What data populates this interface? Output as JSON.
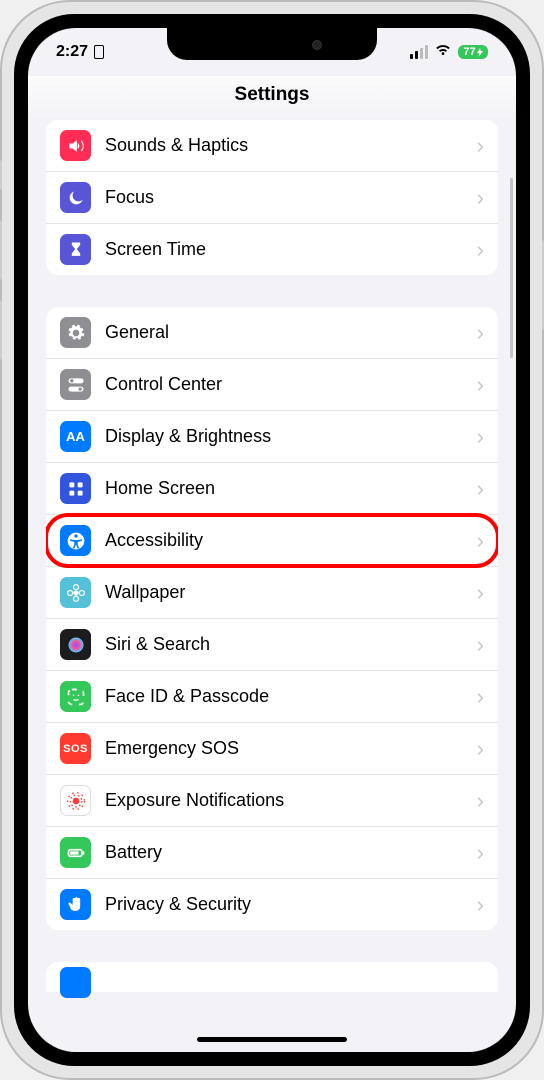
{
  "status": {
    "time": "2:27",
    "battery": "77"
  },
  "title": "Settings",
  "group1": [
    {
      "label": "Sounds & Haptics",
      "icon": "speaker-icon",
      "bg": "#ff2d55"
    },
    {
      "label": "Focus",
      "icon": "moon-icon",
      "bg": "#5856d6"
    },
    {
      "label": "Screen Time",
      "icon": "hourglass-icon",
      "bg": "#5856d6"
    }
  ],
  "group2": [
    {
      "label": "General",
      "icon": "gear-icon",
      "bg": "#8e8e93"
    },
    {
      "label": "Control Center",
      "icon": "toggles-icon",
      "bg": "#8e8e93"
    },
    {
      "label": "Display & Brightness",
      "icon": "text-size-icon",
      "bg": "#007aff"
    },
    {
      "label": "Home Screen",
      "icon": "grid-icon",
      "bg": "#3355dd"
    },
    {
      "label": "Accessibility",
      "icon": "accessibility-icon",
      "bg": "#007aff",
      "highlighted": true
    },
    {
      "label": "Wallpaper",
      "icon": "flower-icon",
      "bg": "#55c1d9"
    },
    {
      "label": "Siri & Search",
      "icon": "siri-icon",
      "bg": "#1c1c1e"
    },
    {
      "label": "Face ID & Passcode",
      "icon": "faceid-icon",
      "bg": "#34c759"
    },
    {
      "label": "Emergency SOS",
      "icon": "sos-icon",
      "bg": "#ff3b30"
    },
    {
      "label": "Exposure Notifications",
      "icon": "exposure-icon",
      "bg": "#ffffff"
    },
    {
      "label": "Battery",
      "icon": "battery-icon",
      "bg": "#34c759"
    },
    {
      "label": "Privacy & Security",
      "icon": "hand-icon",
      "bg": "#007aff"
    }
  ],
  "highlight_color": "#ff0000"
}
